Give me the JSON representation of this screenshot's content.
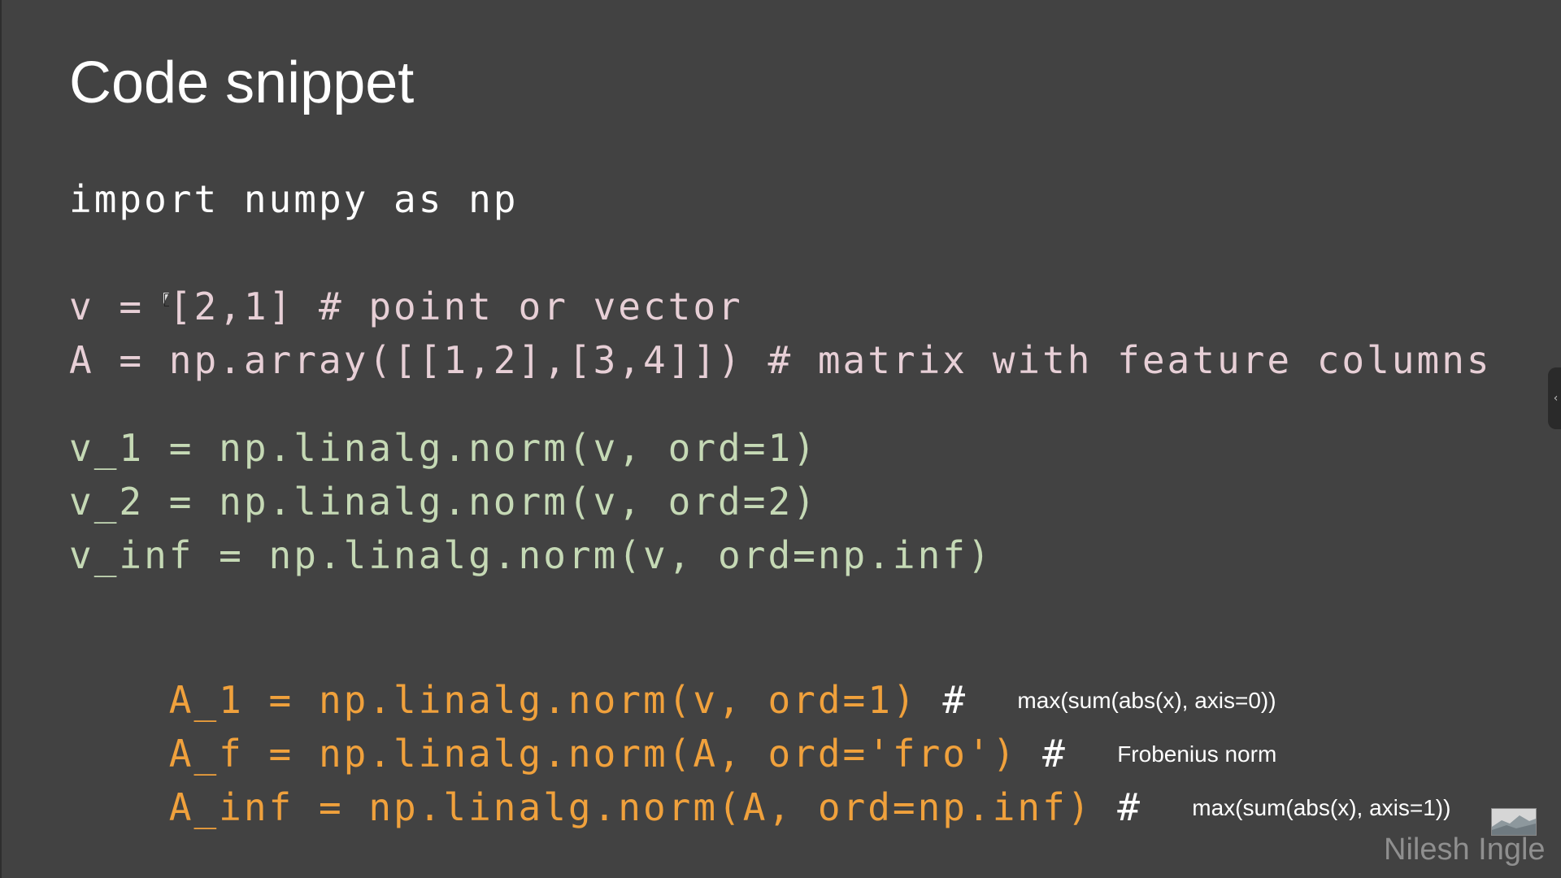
{
  "slide": {
    "title": "Code snippet",
    "code": {
      "import_line": "import numpy as np",
      "v_def": {
        "code": "v = [2,1] # point or vector"
      },
      "A_def": {
        "code": "A = np.array([[1,2],[3,4]]) # matrix with feature columns"
      },
      "v1": "v_1 = np.linalg.norm(v, ord=1)",
      "v2": "v_2 = np.linalg.norm(v, ord=2)",
      "vinf": "v_inf = np.linalg.norm(v, ord=np.inf)",
      "A1": {
        "code": "A_1 = np.linalg.norm(v, ord=1)",
        "hash": "#",
        "note": "max(sum(abs(x), axis=0))"
      },
      "Af": {
        "code": "A_f = np.linalg.norm(A, ord='fro')",
        "hash": "#",
        "note": "Frobenius norm"
      },
      "Ainf": {
        "code": "A_inf = np.linalg.norm(A, ord=np.inf)",
        "hash": "#",
        "note": "max(sum(abs(x), axis=1))"
      }
    },
    "watermark": "Nilesh Ingle",
    "side_handle_icon": "‹"
  },
  "colors": {
    "background": "#424242",
    "import_text": "#ffffff",
    "vector_matrix_text": "#e7cfd6",
    "vector_norm_text": "#c5d9b5",
    "matrix_norm_text": "#f0a13c",
    "watermark_text": "#8f8f8f"
  }
}
